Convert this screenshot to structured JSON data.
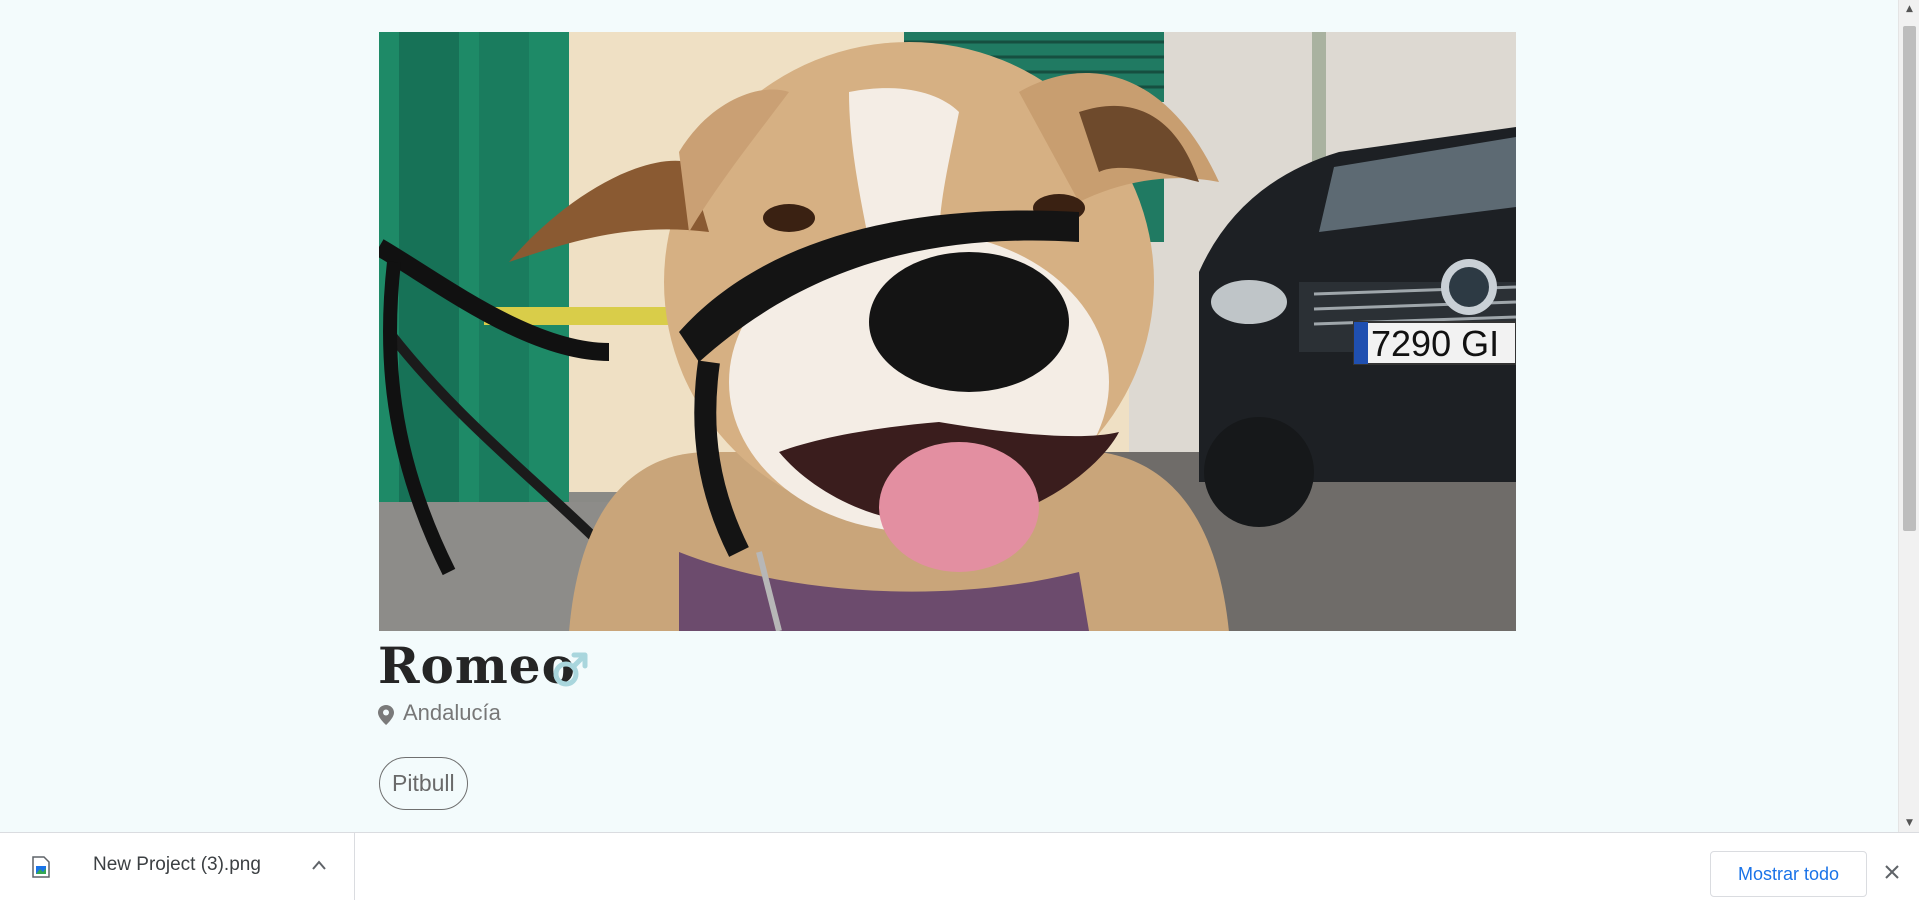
{
  "pet": {
    "name": "Romeo",
    "sex_icon": "male-symbol-icon",
    "location": "Andalucía",
    "breed": "Pitbull"
  },
  "photo": {
    "subject": "dog-photo",
    "plate_text": "7290 GI"
  },
  "downloads": {
    "file_name": "New Project (3).png",
    "show_all_label": "Mostrar todo"
  },
  "colors": {
    "page_bg": "#f3fbfc",
    "sex_icon": "#a9d6dd",
    "link_blue": "#1a73e8"
  }
}
